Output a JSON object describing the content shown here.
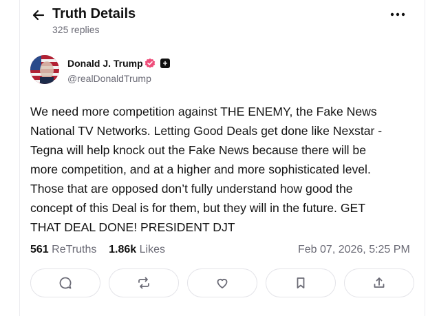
{
  "header": {
    "title": "Truth Details",
    "replies": "325 replies",
    "back_icon": "arrow-left-icon",
    "more_icon": "more-horizontal-icon"
  },
  "author": {
    "name": "Donald J. Trump",
    "handle": "@realDonaldTrump",
    "verified_color": "#ef4d7a"
  },
  "post": {
    "body": "We need more competition against THE ENEMY, the Fake News\nNational TV Networks. Letting Good Deals get done like Nexstar -\nTegna will help knock out the Fake News because there will be\nmore competition, and at a higher and more sophisticated level.\nThose that are opposed don’t fully understand how good the\nconcept of this Deal is for them, but they will in the future. GET\nTHAT DEAL DONE! PRESIDENT DJT",
    "retruths_count": "561",
    "retruths_label": "ReTruths",
    "likes_count": "1.86k",
    "likes_label": "Likes",
    "timestamp": "Feb 07, 2026, 5:25 PM"
  },
  "actions": [
    {
      "icon": "reply-icon"
    },
    {
      "icon": "retruth-icon"
    },
    {
      "icon": "like-icon"
    },
    {
      "icon": "bookmark-icon"
    },
    {
      "icon": "share-icon"
    }
  ]
}
